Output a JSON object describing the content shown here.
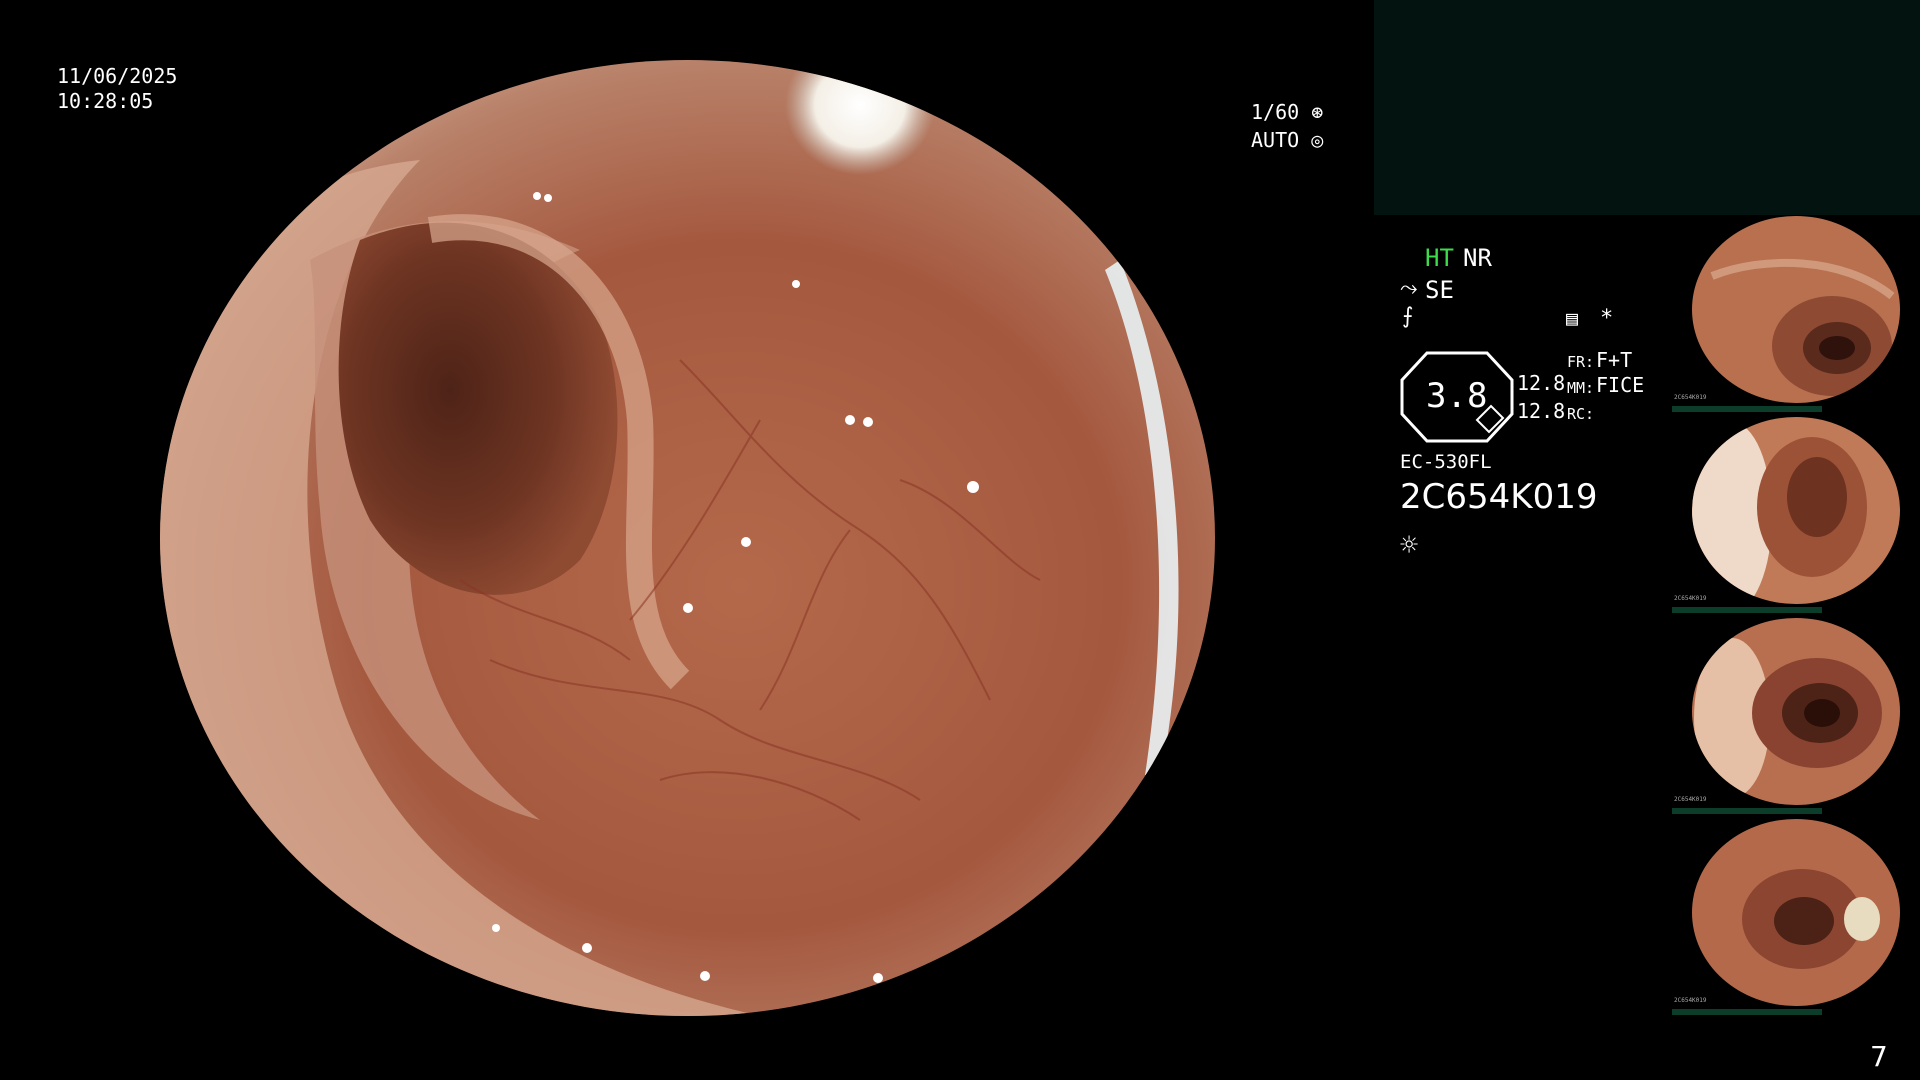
{
  "timestamp": {
    "date": "11/06/2025",
    "time": "10:28:05"
  },
  "exposure": {
    "shutter": "1/60",
    "mode": "AUTO",
    "shutter_icon": "aperture-icon",
    "mode_icon": "iris-icon"
  },
  "status": {
    "ht": "HT",
    "nr": "NR",
    "se": "SE",
    "star": "*",
    "zoom": "3.8",
    "values": [
      "12.8",
      "12.8"
    ],
    "keys": [
      "FR:",
      "MM:",
      "RC:"
    ],
    "fr_value": "F+T",
    "mm_value": "FICE",
    "scope_model": "EC-530FL",
    "serial": "2C654K019"
  },
  "thumbnails": [
    {
      "mini_serial": "2C654K019"
    },
    {
      "mini_serial": "2C654K019"
    },
    {
      "mini_serial": "2C654K019"
    },
    {
      "mini_serial": "2C654K019"
    }
  ],
  "page_number": "7",
  "colors": {
    "ht_green": "#3ddc4a",
    "panel_dark": "#031410",
    "thumb_bar": "#0b3d2a"
  }
}
